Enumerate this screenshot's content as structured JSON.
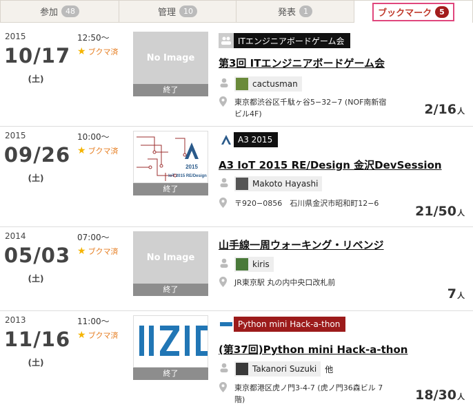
{
  "tabs": [
    {
      "label": "参加",
      "count": "48"
    },
    {
      "label": "管理",
      "count": "10"
    },
    {
      "label": "発表",
      "count": "1"
    },
    {
      "label": "ブックマーク",
      "count": "5"
    }
  ],
  "events": [
    {
      "year": "2015",
      "date": "10/17",
      "dow": "(土)",
      "time": "12:50〜",
      "bookmark": "ブクマ済",
      "thumb": "No Image",
      "ended": "終了",
      "group": "ITエンジニアボードゲーム会",
      "title": "第3回 ITエンジニアボードゲーム会",
      "owner": "cactusman",
      "owner_extra": "",
      "address": "東京都渋谷区千駄ヶ谷5−32−7 (NOF南新宿ビル4F)",
      "count": "2/16",
      "unit": "人"
    },
    {
      "year": "2015",
      "date": "09/26",
      "dow": "(土)",
      "time": "10:00〜",
      "bookmark": "ブクマ済",
      "thumb": "",
      "ended": "終了",
      "group": "A3 2015",
      "title": "A3 IoT 2015 RE/Design 金沢DevSession",
      "owner": "Makoto Hayashi",
      "owner_extra": "",
      "address": "〒920−0856　石川県金沢市昭和町12−6",
      "count": "21/50",
      "unit": "人"
    },
    {
      "year": "2014",
      "date": "05/03",
      "dow": "(土)",
      "time": "07:00〜",
      "bookmark": "ブクマ済",
      "thumb": "No Image",
      "ended": "終了",
      "group": "",
      "title": "山手線一周ウォーキング・リベンジ",
      "owner": "kiris",
      "owner_extra": "",
      "address": "JR東京駅 丸の内中央口改札前",
      "count": "7",
      "unit": "人"
    },
    {
      "year": "2013",
      "date": "11/16",
      "dow": "(土)",
      "time": "11:00〜",
      "bookmark": "ブクマ済",
      "thumb": "",
      "ended": "終了",
      "group": "Python mini Hack-a-thon",
      "title": "(第37回)Python mini Hack-a-thon",
      "owner": "Takanori Suzuki",
      "owner_extra": "他",
      "address": "東京都港区虎ノ門3-4-7 (虎ノ門36森ビル 7階)",
      "count": "18/30",
      "unit": "人"
    }
  ],
  "colors": {
    "accent": "#e0467c",
    "badge_active": "#a31c1c",
    "bookmark": "#e67e22"
  }
}
